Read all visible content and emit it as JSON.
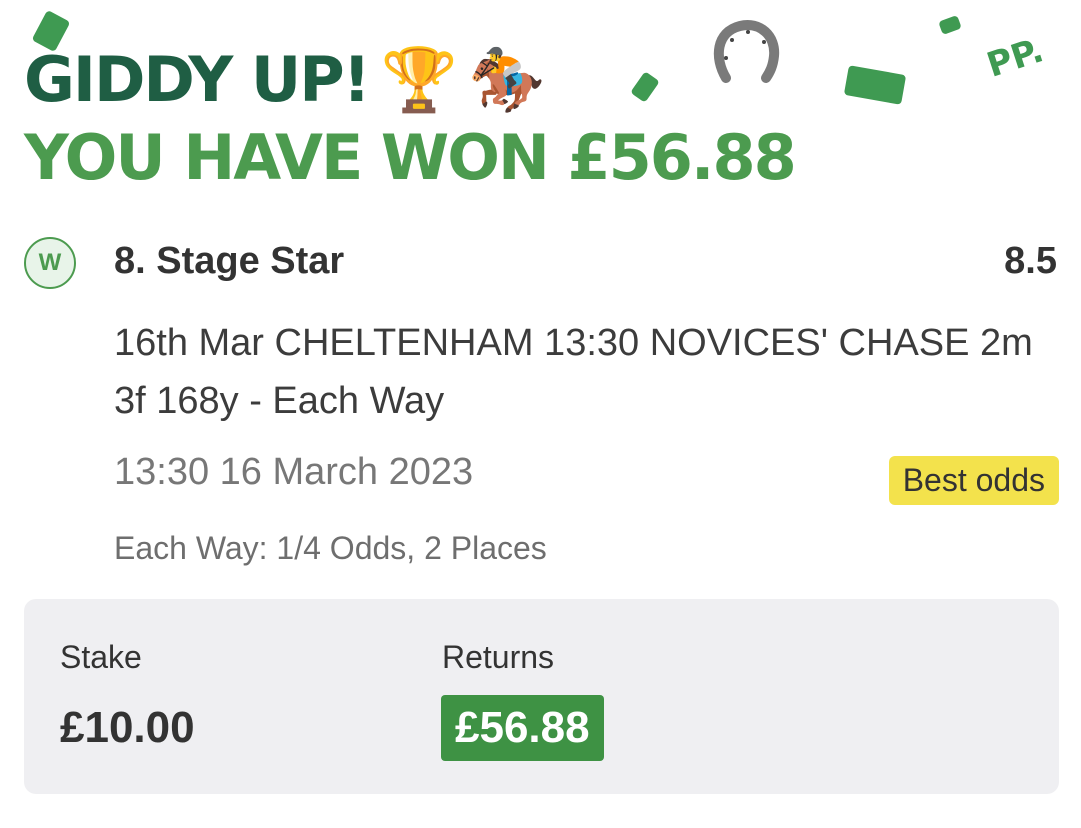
{
  "header": {
    "line1": "GIDDY UP!",
    "line1_emoji_trophy": "🏆",
    "line1_emoji_horse": "🏇",
    "line2": "YOU HAVE WON £56.88",
    "brand_mark": "PP."
  },
  "selection": {
    "result_badge": "W",
    "runner": "8. Stage Star",
    "odds": "8.5",
    "market": "16th Mar CHELTENHAM 13:30 NOVICES' CHASE 2m 3f 168y - Each Way",
    "event_time": "13:30 16 March 2023",
    "best_odds_tag": "Best odds",
    "each_way_terms": "Each Way: 1/4 Odds, 2 Places"
  },
  "summary": {
    "stake_label": "Stake",
    "stake_value": "£10.00",
    "returns_label": "Returns",
    "returns_value": "£56.88"
  },
  "colors": {
    "dark_green": "#1f5e44",
    "bright_green": "#4c9b4f",
    "returns_bg": "#3e9244",
    "best_odds_bg": "#f3e24c",
    "card_bg": "#efeff2"
  },
  "icons": [
    "trophy-icon",
    "horse-racing-icon",
    "horseshoe-icon",
    "banknote-icon"
  ]
}
